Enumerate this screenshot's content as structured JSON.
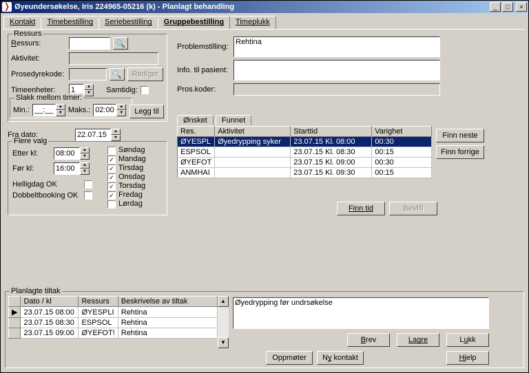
{
  "title": "Øyeundersøkelse, Iris  224965-05216 (k) - Planlagt behandling",
  "winbtns": {
    "min": "_",
    "max": "□",
    "close": "×"
  },
  "tabs": [
    "Kontakt",
    "Timebestilling",
    "Seriebestilling",
    "Gruppebestilling",
    "Timeplukk"
  ],
  "active_tab_index": 3,
  "ressurs": {
    "legend": "Ressurs",
    "labels": {
      "ressurs": "Ressurs:",
      "aktivitet": "Aktivitet:",
      "prosedyrekode": "Prosedyrekode:",
      "rediger": "Rediger",
      "timeenheter": "Timeenheter:",
      "samtidig": "Samtidig:",
      "leggtil": "Legg til"
    },
    "timeenheter_value": "1",
    "slakk": {
      "legend": "Slakk mellom timer:",
      "min_lbl": "Min.:",
      "min_val": "__:__",
      "maks_lbl": "Maks.:",
      "maks_val": "02:00"
    }
  },
  "fra_dato_lbl": "Fra dato:",
  "fra_dato_val": "22.07.15",
  "flere": {
    "legend": "Flere valg",
    "etter_lbl": "Etter kl:",
    "etter_val": "08:00",
    "foer_lbl": "Før kl:",
    "foer_val": "16:00",
    "helligdag_lbl": "Helligdag OK",
    "dobbelt_lbl": "Dobbeltbooking OK",
    "days": [
      {
        "name": "Søndag",
        "checked": false
      },
      {
        "name": "Mandag",
        "checked": true
      },
      {
        "name": "Tirsdag",
        "checked": true
      },
      {
        "name": "Onsdag",
        "checked": true
      },
      {
        "name": "Torsdag",
        "checked": true
      },
      {
        "name": "Fredag",
        "checked": true
      },
      {
        "name": "Lørdag",
        "checked": false
      }
    ]
  },
  "right": {
    "problemstilling_lbl": "Problemstilling:",
    "problemstilling_val": "Rehtina",
    "info_lbl": "Info. til pasient:",
    "pros_lbl": "Pros.koder:"
  },
  "subtabs": {
    "oensket": "Ønsket",
    "funnet": "Funnet"
  },
  "found": {
    "headers": [
      "Res.",
      "Aktivitet",
      "Starttid",
      "Varighet"
    ],
    "rows": [
      {
        "res": "ØYESPL",
        "akt": "Øyedrypping syker",
        "start": "23.07.15 Kl. 08:00",
        "var": "00:30",
        "sel": true
      },
      {
        "res": "ESPSOL",
        "akt": "",
        "start": "23.07.15 Kl. 08:30",
        "var": "00:15",
        "sel": false
      },
      {
        "res": "ØYEFOT",
        "akt": "",
        "start": "23.07.15 Kl. 09:00",
        "var": "00:30",
        "sel": false
      },
      {
        "res": "ANMHAI",
        "akt": "",
        "start": "23.07.15 Kl. 09:30",
        "var": "00:15",
        "sel": false
      }
    ],
    "buttons": {
      "finn_neste": "Finn neste",
      "finn_forrige": "Finn forrige",
      "finn_tid": "Finn tid",
      "bestill": "Bestill"
    }
  },
  "planlagte": {
    "legend": "Planlagte tiltak",
    "headers": [
      "Dato / kl",
      "Ressurs",
      "Beskrivelse av tiltak"
    ],
    "rows": [
      {
        "dt": "23.07.15 08:00",
        "res": "ØYESPLI",
        "besk": "Rehtina",
        "mark": "▶"
      },
      {
        "dt": "23.07.15 08:30",
        "res": "ESPSOL",
        "besk": "Rehtina",
        "mark": ""
      },
      {
        "dt": "23.07.15 09:00",
        "res": "ØYEFOT!",
        "besk": "Rehtina",
        "mark": ""
      }
    ],
    "desc": "Øyedrypping før undrsøkelse"
  },
  "bottom_btns": {
    "brev": "Brev",
    "lagre": "Lagre",
    "lukk": "Lukk",
    "oppmoeter": "Oppmøter",
    "ny_kontakt": "Ny kontakt",
    "hjelp": "Hjelp"
  }
}
